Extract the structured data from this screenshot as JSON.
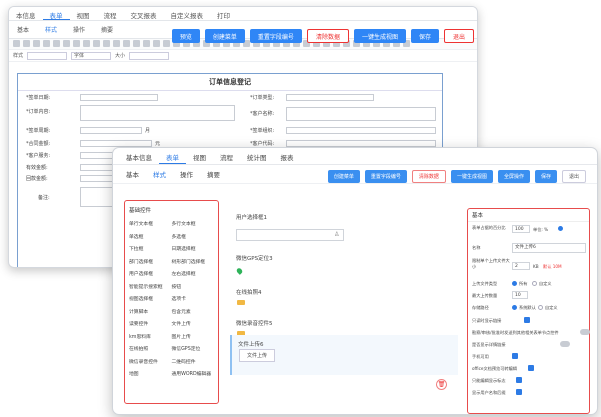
{
  "back_window": {
    "menu": [
      "本信息",
      "表单",
      "视图",
      "流程",
      "交叉报表",
      "自定义报表",
      "打印"
    ],
    "tabs": [
      "基本",
      "样式",
      "操作",
      "摘要"
    ],
    "buttons": [
      "预览",
      "创建菜单",
      "重置字段编号",
      "清除数据",
      "一键生成视图",
      "保存",
      "退出"
    ],
    "toolbar2": {
      "font_label": "样式",
      "font_select": "字体",
      "size_label": "大小"
    },
    "form": {
      "title": "订单信息登记",
      "left_labels": [
        "*签单日期:",
        "*订单内容:",
        "*签单周期:",
        "*合同金额:",
        "*客户服务:",
        "有效金额:",
        "回款金额:",
        "备注:"
      ],
      "right_labels": [
        "*订单类型:",
        "*客户名称:",
        "*签单组织:",
        "*客户代码:"
      ],
      "unit_1": "月",
      "unit_2": "元",
      "unit_3": "元"
    }
  },
  "front_window": {
    "menu": [
      "基本信息",
      "表单",
      "视图",
      "流程",
      "统计图",
      "报表"
    ],
    "tabs": [
      "基本",
      "样式",
      "操作",
      "摘要"
    ],
    "buttons": [
      "创建菜单",
      "重置字段编号",
      "清除数据",
      "一键生成视图",
      "全屏操作",
      "保存",
      "退出"
    ],
    "controls": {
      "title": "基础控件",
      "items": [
        "单行文本框",
        "多行文本框",
        "单选框",
        "多选框",
        "下拉框",
        "日期选择框",
        "部门选择框",
        "树形部门选择框",
        "用户选择框",
        "左右选择框",
        "智能提示搜索框",
        "按钮",
        "视图选择框",
        "选项卡",
        "计算脚本",
        "包含元素",
        "读要控件",
        "文件上传",
        "km思料库",
        "图片上传",
        "在线拍照",
        "微信GPS定位",
        "微信录音控件",
        "二维码控件",
        "地图",
        "通用WORD编辑器"
      ]
    },
    "canvas": {
      "field1": "用户选择框1",
      "field2": "微信GPS定位3",
      "field3": "在线拍照4",
      "field4": "微信录音控件5",
      "field5": "文件上传6",
      "upload_button": "文件上传"
    },
    "properties": {
      "header": "基本",
      "width_label": "表单占据的百分比",
      "width_value": "100",
      "width_unit": "单位: %",
      "name_label": "名称",
      "name_value": "文件上传6",
      "size_label": "限制单个上传文件大小",
      "size_value": "2",
      "size_unit": "KB",
      "size_note": "默认 10M",
      "type_label": "上传文件类型",
      "type_opt1": "所有",
      "type_opt2": "自定义",
      "max_label": "最大上传数量",
      "max_value": "10",
      "store_label": "存储路径",
      "store_opt1": "系统默认",
      "store_opt2": "自定义",
      "flags": [
        "只读时显示链接",
        "勘察/审核/批准时发送到其他相关表单节点控件",
        "是否显示详情链接",
        "手机可用",
        "office文档预览可转编辑",
        "只能编辑显示标志",
        "显示用户名和后缀"
      ]
    }
  }
}
